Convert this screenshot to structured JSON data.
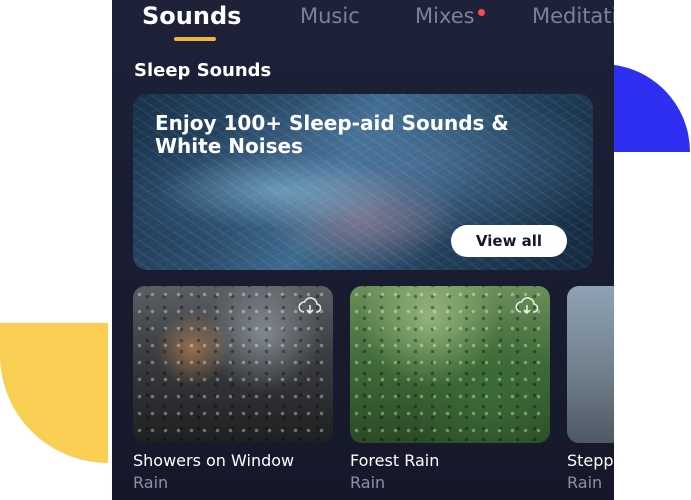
{
  "tabs": [
    {
      "label": "Sounds",
      "active": true
    },
    {
      "label": "Music",
      "active": false
    },
    {
      "label": "Mixes",
      "active": false,
      "badge": true
    },
    {
      "label": "Meditati",
      "active": false
    }
  ],
  "section": {
    "title": "Sleep Sounds"
  },
  "banner": {
    "title": "Enjoy 100+ Sleep-aid Sounds & White Noises",
    "button_label": "View all"
  },
  "cards": [
    {
      "title": "Showers on Window",
      "subtitle": "Rain",
      "icon": "cloud-download-icon"
    },
    {
      "title": "Forest Rain",
      "subtitle": "Rain",
      "icon": "cloud-download-icon"
    },
    {
      "title": "Stepp",
      "subtitle": "Rain"
    }
  ],
  "colors": {
    "background": "#1d2239",
    "accent": "#f2b53a",
    "badge": "#ff4a4a",
    "deco_blue": "#2f2ff2",
    "deco_yellow": "#f8cf52"
  }
}
